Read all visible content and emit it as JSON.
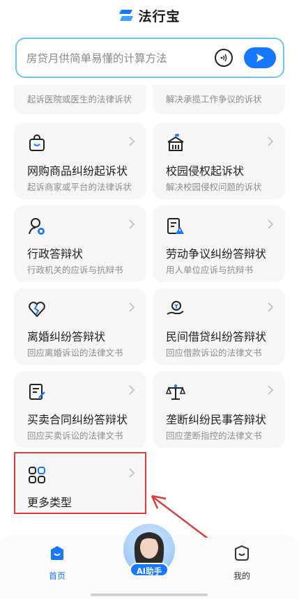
{
  "app": {
    "title": "法行宝",
    "brand_color": "#1677ff"
  },
  "search": {
    "placeholder": "房贷月供简单易懂的计算方法"
  },
  "cards_partial": [
    {
      "subtitle": "起诉医院或医生的法律诉状"
    },
    {
      "subtitle": "解决承揽工作争议的诉状"
    }
  ],
  "cards": [
    {
      "title": "网购商品纠纷起诉状",
      "subtitle": "起诉商家或平台的法律诉状",
      "icon": "shopping-bag-icon"
    },
    {
      "title": "校园侵权起诉状",
      "subtitle": "解决校园侵权问题的诉状",
      "icon": "school-building-icon"
    },
    {
      "title": "行政答辩状",
      "subtitle": "行政机关的应诉与抗辩书",
      "icon": "official-person-icon"
    },
    {
      "title": "劳动争议纠纷答辩状",
      "subtitle": "用人单位应诉与抗辩书",
      "icon": "document-warning-icon"
    },
    {
      "title": "离婚纠纷答辩状",
      "subtitle": "回应离婚诉讼的法律文书",
      "icon": "broken-heart-icon"
    },
    {
      "title": "民间借贷纠纷答辩状",
      "subtitle": "回应借款诉讼的法律文书",
      "icon": "money-hand-icon"
    },
    {
      "title": "买卖合同纠纷答辩状",
      "subtitle": "回应买卖诉讼的法律文书",
      "icon": "contract-icon"
    },
    {
      "title": "垄断纠纷民事答辩状",
      "subtitle": "回应垄断指控的法律文书",
      "icon": "scales-icon"
    },
    {
      "title": "更多类型",
      "subtitle": "",
      "icon": "grid-more-icon"
    }
  ],
  "nav": {
    "home_label": "首页",
    "ai_label": "AI助手",
    "mine_label": "我的"
  },
  "annotation": {
    "highlight_color": "#e03a3a"
  }
}
